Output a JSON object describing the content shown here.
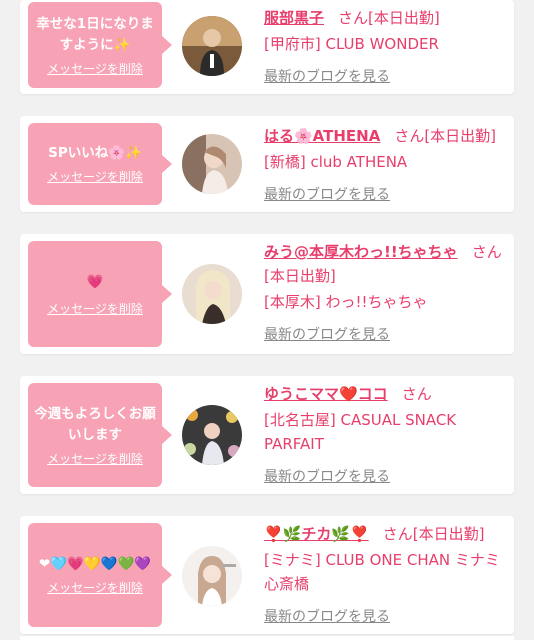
{
  "cards": [
    {
      "message": "幸せな1日になりますように✨",
      "delete_label": "メッセージを削除",
      "name": "服部黒子",
      "suffix": "さん[本日出勤]",
      "shop": "[甲府市] CLUB WONDER",
      "blog_label": "最新のブログを見る"
    },
    {
      "message": "SPいいね🌸✨",
      "delete_label": "メッセージを削除",
      "name": "はる🌸ATHENA",
      "suffix": "さん[本日出勤]",
      "shop": "[新橋] club ATHENA",
      "blog_label": "最新のブログを見る"
    },
    {
      "message": "💗",
      "delete_label": "メッセージを削除",
      "name": "みう@本厚木わっ!!ちゃちゃ",
      "suffix": "さん[本日出勤]",
      "shop": "[本厚木] わっ!!ちゃちゃ",
      "blog_label": "最新のブログを見る"
    },
    {
      "message": "今週もよろしくお願いします",
      "delete_label": "メッセージを削除",
      "name": "ゆうこママ❤️ココ",
      "suffix": "さん",
      "shop": "[北名古屋] CASUAL SNACK PARFAIT",
      "blog_label": "最新のブログを見る"
    },
    {
      "message": "❤🩵💗💛💙💚💜",
      "delete_label": "メッセージを削除",
      "name": "❣️🌿チカ🌿❣️",
      "suffix": "さん[本日出勤]",
      "shop": "[ミナミ] CLUB ONE CHAN ミナミ 心斎橋",
      "blog_label": "最新のブログを見る"
    }
  ]
}
